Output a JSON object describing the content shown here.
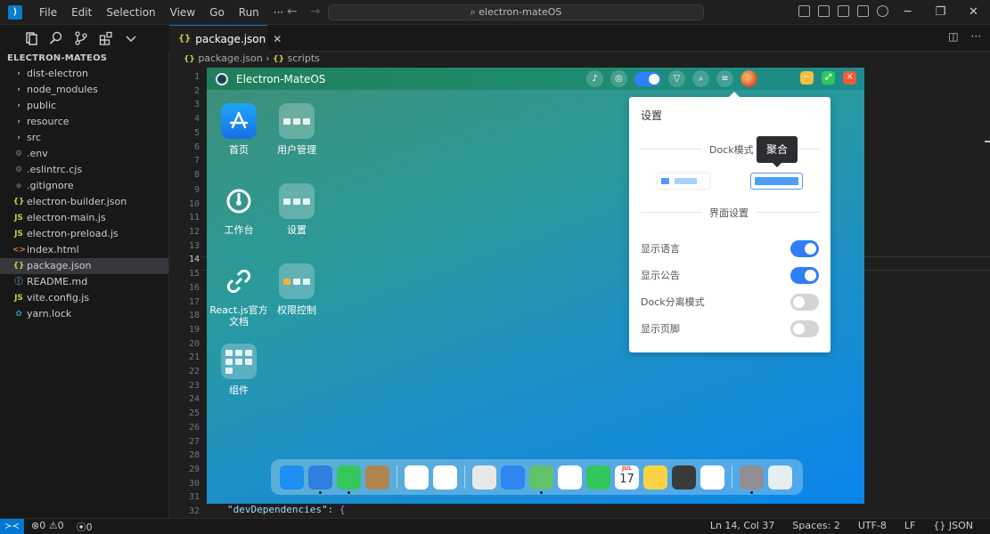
{
  "window": {
    "title": "electron-mateOS"
  },
  "menu": [
    "File",
    "Edit",
    "Selection",
    "View",
    "Go",
    "Run",
    "···"
  ],
  "explorer": {
    "header": "ELECTRON-MATEOS",
    "items": [
      {
        "name": "dist-electron",
        "kind": "folder"
      },
      {
        "name": "node_modules",
        "kind": "folder"
      },
      {
        "name": "public",
        "kind": "folder"
      },
      {
        "name": "resource",
        "kind": "folder"
      },
      {
        "name": "src",
        "kind": "folder"
      },
      {
        "name": ".env",
        "kind": "gear",
        "color": "#6d8086"
      },
      {
        "name": ".eslintrc.cjs",
        "kind": "gear",
        "color": "#6d8086"
      },
      {
        "name": ".gitignore",
        "kind": "git",
        "color": "#41535b"
      },
      {
        "name": "electron-builder.json",
        "kind": "json",
        "color": "#cbcb41"
      },
      {
        "name": "electron-main.js",
        "kind": "js",
        "color": "#cbcb41"
      },
      {
        "name": "electron-preload.js",
        "kind": "js",
        "color": "#cbcb41"
      },
      {
        "name": "index.html",
        "kind": "html",
        "color": "#e37933"
      },
      {
        "name": "package.json",
        "kind": "json",
        "color": "#cbcb41",
        "selected": true
      },
      {
        "name": "README.md",
        "kind": "info",
        "color": "#519aba"
      },
      {
        "name": "vite.config.js",
        "kind": "js",
        "color": "#cbcb41"
      },
      {
        "name": "yarn.lock",
        "kind": "yarn",
        "color": "#2c8ebb"
      }
    ]
  },
  "editor": {
    "tab": "package.json",
    "breadcrumb": [
      "package.json",
      "scripts"
    ],
    "line_numbers": [
      "1",
      "2",
      "3",
      "4",
      "5",
      "6",
      "7",
      "8",
      "9",
      "10",
      "11",
      "12",
      "13",
      "14",
      "15",
      "16",
      "17",
      "18",
      "19",
      "20",
      "21",
      "22",
      "23",
      "24",
      "25",
      "26",
      "27",
      "28",
      "29",
      "30",
      "31",
      "32"
    ],
    "active_line": "14",
    "last_line": {
      "key": "\"devDependencies\"",
      "punct": ": ",
      "brace": "{"
    }
  },
  "preview": {
    "title": "Electron-MateOS",
    "desktop": [
      {
        "label": "首页",
        "icon": "app-store"
      },
      {
        "label": "用户管理",
        "icon": "folder"
      },
      {
        "label": "工作台",
        "icon": "dashboard"
      },
      {
        "label": "设置",
        "icon": "folder"
      },
      {
        "label": "React.js官方文档",
        "icon": "link"
      },
      {
        "label": "权限控制",
        "icon": "folder"
      },
      {
        "label": "组件",
        "icon": "folder"
      }
    ],
    "settings": {
      "title": "设置",
      "dock_mode_label": "Dock模式",
      "dock_tooltip": "聚合",
      "ui_settings_label": "界面设置",
      "toggles": [
        {
          "label": "显示语言",
          "on": true
        },
        {
          "label": "显示公告",
          "on": true
        },
        {
          "label": "Dock分离模式",
          "on": false
        },
        {
          "label": "显示页脚",
          "on": false
        }
      ]
    },
    "dock": [
      {
        "name": "app-store",
        "color": "#1d8ef2",
        "running": false
      },
      {
        "name": "safari",
        "color": "#2f7ee0",
        "running": true
      },
      {
        "name": "messages",
        "color": "#34c759",
        "running": true
      },
      {
        "name": "contacts",
        "color": "#b08550",
        "running": false
      },
      {
        "name": "monitor",
        "color": "#ffffff",
        "running": false
      },
      {
        "name": "info",
        "color": "#ffffff",
        "running": false
      },
      {
        "name": "launchpad",
        "color": "#e8e8e8",
        "running": false
      },
      {
        "name": "mail",
        "color": "#2f86f0",
        "running": false
      },
      {
        "name": "maps",
        "color": "#62c26a",
        "running": true
      },
      {
        "name": "photos",
        "color": "#ffffff",
        "running": false
      },
      {
        "name": "facetime",
        "color": "#31c75a",
        "running": false
      },
      {
        "name": "calendar",
        "color": "#ffffff",
        "running": false
      },
      {
        "name": "notes",
        "color": "#fbd245",
        "running": false
      },
      {
        "name": "calculator",
        "color": "#3a3a3a",
        "running": false
      },
      {
        "name": "music",
        "color": "#ffffff",
        "running": false
      },
      {
        "name": "system-settings",
        "color": "#8e8e93",
        "running": true
      },
      {
        "name": "trash",
        "color": "#e6eef2",
        "running": false
      }
    ],
    "calendar": {
      "month": "JUL",
      "day": "17"
    }
  },
  "status": {
    "remote": "≻≺",
    "errors": "0",
    "warnings": "0",
    "ports": "0",
    "position": "Ln 14, Col 37",
    "spaces": "Spaces: 2",
    "encoding": "UTF-8",
    "eol": "LF",
    "language": "JSON"
  }
}
